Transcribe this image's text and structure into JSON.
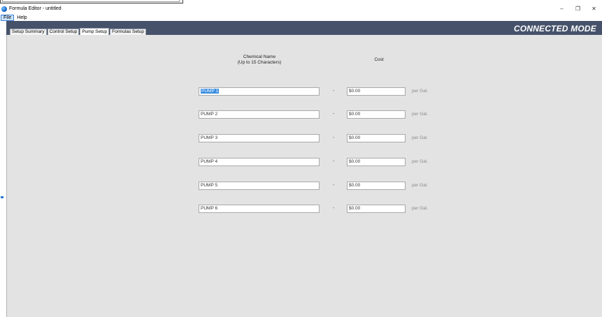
{
  "window": {
    "title": "Formula Editor - untitled",
    "controls": {
      "minimize": "–",
      "maximize": "❐",
      "close": "✕"
    }
  },
  "menu": {
    "items": [
      {
        "label": "File"
      },
      {
        "label": "Help"
      }
    ]
  },
  "header": {
    "mode": "CONNECTED MODE"
  },
  "tabs": [
    {
      "label": "Setup Summary"
    },
    {
      "label": "Control Setup"
    },
    {
      "label": "Pump Setup"
    },
    {
      "label": "Formulas Setup"
    }
  ],
  "active_tab": "Pump Setup",
  "columns": {
    "name_line1": "Chemical Name",
    "name_line2": "(Up to 15 Characters)",
    "cost": "Cost"
  },
  "pumps": [
    {
      "name": "PUMP 1",
      "dash": "-",
      "cost": "$0.00",
      "unit": "per Gal."
    },
    {
      "name": "PUMP 2",
      "dash": "-",
      "cost": "$0.00",
      "unit": "per Gal."
    },
    {
      "name": "PUMP 3",
      "dash": "-",
      "cost": "$0.00",
      "unit": "per Gal."
    },
    {
      "name": "PUMP 4",
      "dash": "-",
      "cost": "$0.00",
      "unit": "per Gal."
    },
    {
      "name": "PUMP 5",
      "dash": "-",
      "cost": "$0.00",
      "unit": "per Gal."
    },
    {
      "name": "PUMP 6",
      "dash": "-",
      "cost": "$0.00",
      "unit": "per Gal."
    }
  ],
  "colors": {
    "band": "#46526a",
    "panel": "#e3e3e3",
    "selection": "#3d8ee0"
  }
}
